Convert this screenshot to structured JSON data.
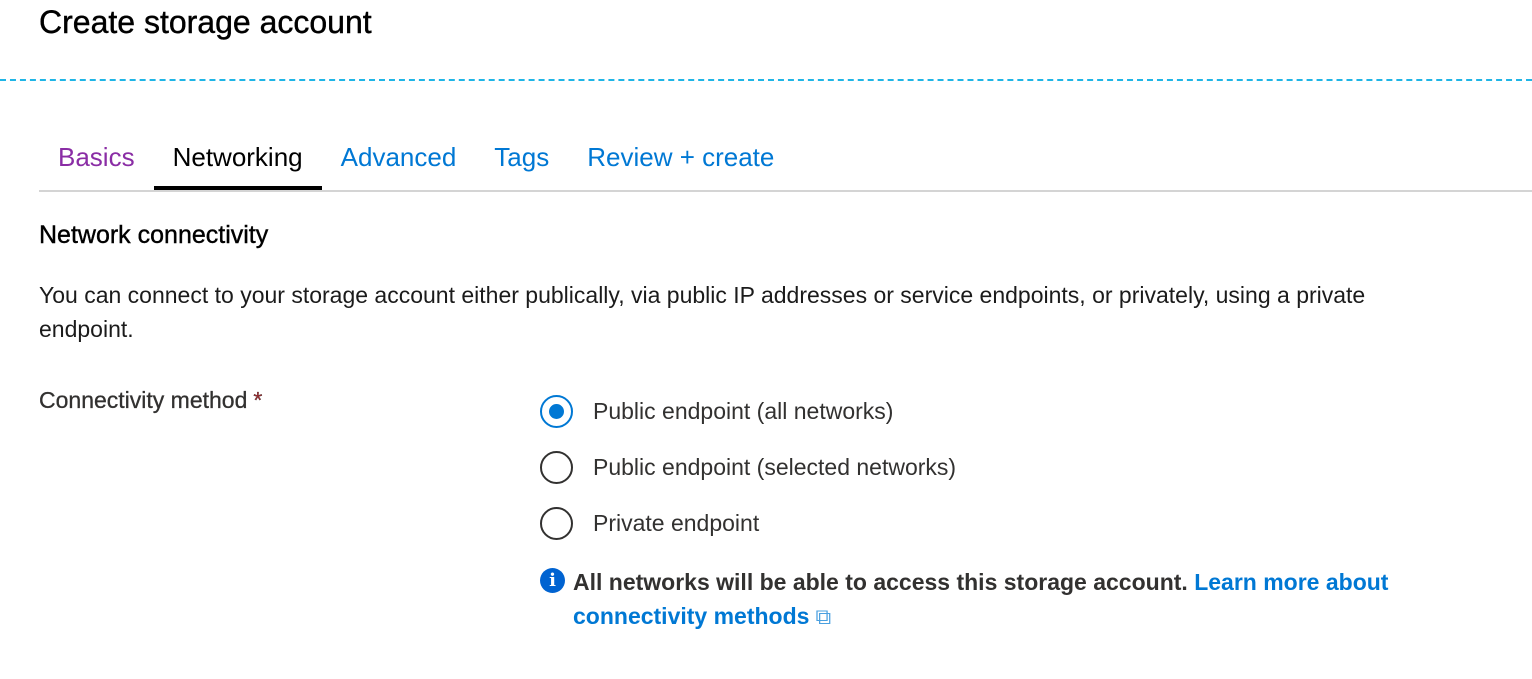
{
  "page": {
    "title": "Create storage account"
  },
  "tabs": [
    {
      "label": "Basics",
      "state": "visited"
    },
    {
      "label": "Networking",
      "state": "active"
    },
    {
      "label": "Advanced",
      "state": "default"
    },
    {
      "label": "Tags",
      "state": "default"
    },
    {
      "label": "Review + create",
      "state": "default"
    }
  ],
  "section": {
    "heading": "Network connectivity",
    "description": "You can connect to your storage account either publically, via public IP addresses or service endpoints, or privately, using a private endpoint."
  },
  "connectivity": {
    "label": "Connectivity method",
    "required_marker": "*",
    "options": [
      {
        "label": "Public endpoint (all networks)",
        "checked": true
      },
      {
        "label": "Public endpoint (selected networks)",
        "checked": false
      },
      {
        "label": "Private endpoint",
        "checked": false
      }
    ],
    "info": {
      "icon": "info-icon",
      "text": "All networks will be able to access this storage account.",
      "link_label": "Learn more about connectivity methods",
      "link_icon": "external-link-icon"
    }
  },
  "colors": {
    "accent": "#0078d4",
    "visited": "#8a2da5",
    "required": "#a4262c",
    "divider": "#1fb5e6"
  }
}
